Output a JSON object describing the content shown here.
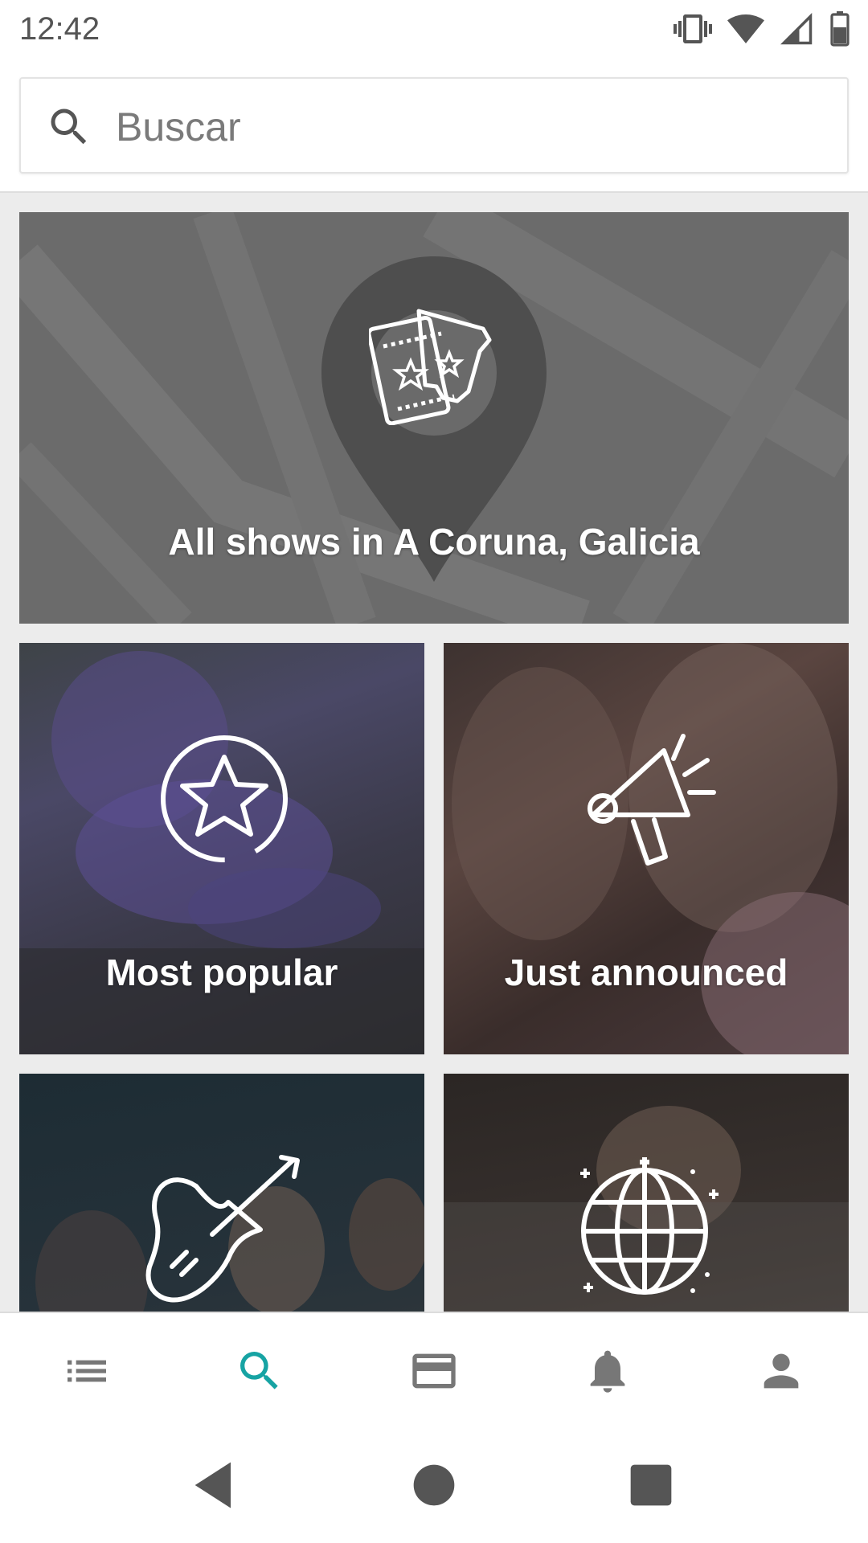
{
  "status_bar": {
    "time": "12:42",
    "icons": [
      "vibrate-icon",
      "wifi-icon",
      "signal-icon",
      "battery-icon"
    ]
  },
  "search": {
    "placeholder": "Buscar",
    "icon": "search-icon"
  },
  "cards": [
    {
      "id": "all-shows",
      "label": "All shows in A Coruna, Galicia",
      "icon": "tickets-location-icon"
    },
    {
      "id": "most-popular",
      "label": "Most popular",
      "icon": "star-badge-icon"
    },
    {
      "id": "just-announced",
      "label": "Just announced",
      "icon": "megaphone-icon"
    },
    {
      "id": "rock",
      "label": "",
      "icon": "guitar-icon"
    },
    {
      "id": "world",
      "label": "",
      "icon": "globe-icon"
    }
  ],
  "bottom_nav": {
    "items": [
      {
        "name": "feed",
        "icon": "list-icon",
        "active": false
      },
      {
        "name": "search",
        "icon": "search-icon",
        "active": true
      },
      {
        "name": "tickets",
        "icon": "ticket-card-icon",
        "active": false
      },
      {
        "name": "notifications",
        "icon": "bell-icon",
        "active": false
      },
      {
        "name": "profile",
        "icon": "person-icon",
        "active": false
      }
    ],
    "active_color": "#16a3a3",
    "inactive_color": "#777777"
  },
  "system_nav": {
    "buttons": [
      "back-icon",
      "home-icon",
      "recents-icon"
    ]
  }
}
